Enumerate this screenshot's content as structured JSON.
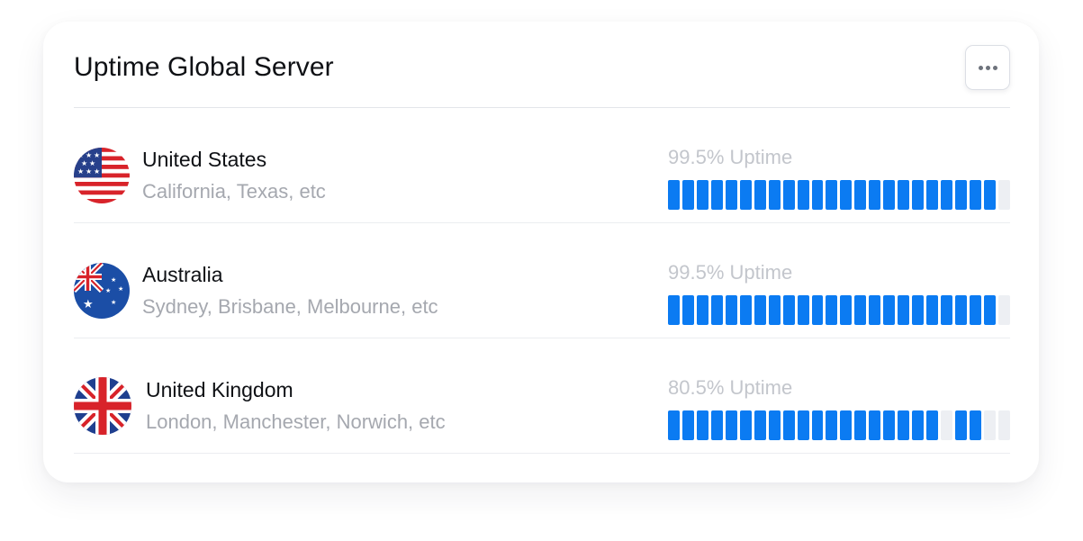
{
  "widget": {
    "title": "Uptime Global Server",
    "menu_icon": "more-horizontal-icon"
  },
  "colors": {
    "accent": "#0b7bf2",
    "segment_off": "#edeff3",
    "muted_text": "#a5a8af",
    "label_text": "#c3c6cc"
  },
  "servers": [
    {
      "country": "United States",
      "flag_icon": "us-flag-icon",
      "regions": "California, Texas, etc",
      "uptime_label": "99.5% Uptime",
      "segments": [
        1,
        1,
        1,
        1,
        1,
        1,
        1,
        1,
        1,
        1,
        1,
        1,
        1,
        1,
        1,
        1,
        1,
        1,
        1,
        1,
        1,
        1,
        1,
        0
      ]
    },
    {
      "country": "Australia",
      "flag_icon": "australia-flag-icon",
      "regions": "Sydney, Brisbane, Melbourne, etc",
      "uptime_label": "99.5% Uptime",
      "segments": [
        1,
        1,
        1,
        1,
        1,
        1,
        1,
        1,
        1,
        1,
        1,
        1,
        1,
        1,
        1,
        1,
        1,
        1,
        1,
        1,
        1,
        1,
        1,
        0
      ]
    },
    {
      "country": "United Kingdom",
      "flag_icon": "uk-flag-icon",
      "regions": "London, Manchester, Norwich, etc",
      "uptime_label": "80.5% Uptime",
      "segments": [
        1,
        1,
        1,
        1,
        1,
        1,
        1,
        1,
        1,
        1,
        1,
        1,
        1,
        1,
        1,
        1,
        1,
        1,
        1,
        0,
        1,
        1,
        0,
        0
      ]
    }
  ]
}
